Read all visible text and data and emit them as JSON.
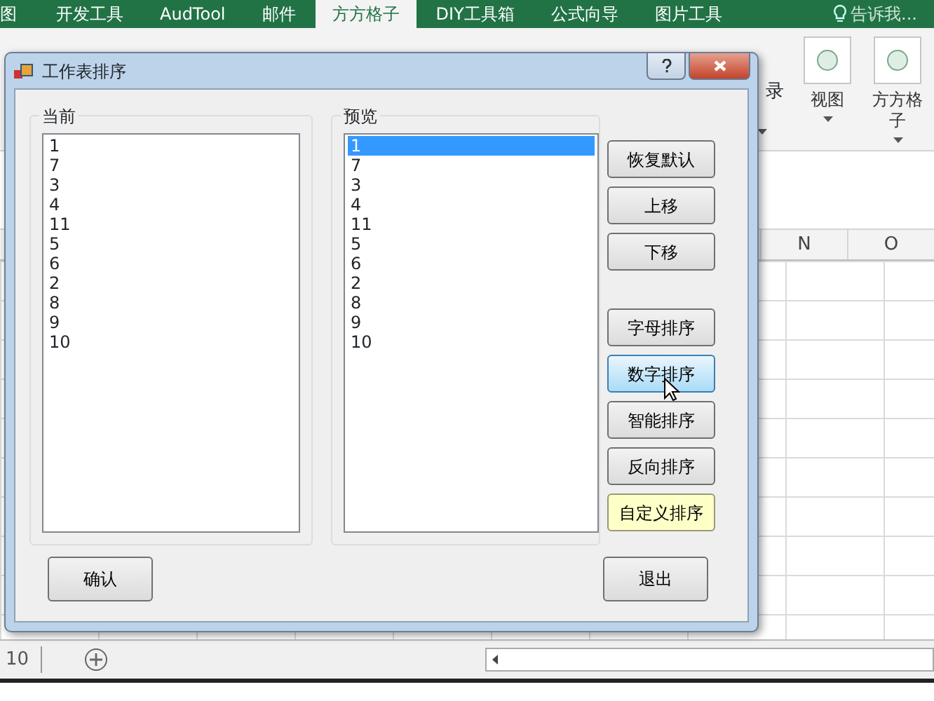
{
  "ribbon_tabs": [
    {
      "label": "图",
      "selected": false
    },
    {
      "label": "开发工具",
      "selected": false
    },
    {
      "label": "AudTool",
      "selected": false
    },
    {
      "label": "邮件",
      "selected": false
    },
    {
      "label": "方方格子",
      "selected": true
    },
    {
      "label": "DIY工具箱",
      "selected": false
    },
    {
      "label": "公式向导",
      "selected": false
    },
    {
      "label": "图片工具",
      "selected": false
    }
  ],
  "tell_me": "告诉我...",
  "ribbon_commands": [
    {
      "label": "视图"
    },
    {
      "label": "方方格子"
    }
  ],
  "ribbon_partial": "录",
  "columns": [
    "N",
    "O"
  ],
  "status_bar": {
    "row_number": "10"
  },
  "dialog": {
    "title": "工作表排序",
    "current": {
      "label": "当前",
      "items": [
        "1",
        "7",
        "3",
        "4",
        "11",
        "5",
        "6",
        "2",
        "8",
        "9",
        "10"
      ]
    },
    "preview": {
      "label": "预览",
      "items": [
        {
          "text": "1",
          "selected": true
        },
        {
          "text": "7",
          "selected": false
        },
        {
          "text": "3",
          "selected": false
        },
        {
          "text": "4",
          "selected": false
        },
        {
          "text": "11",
          "selected": false
        },
        {
          "text": "5",
          "selected": false
        },
        {
          "text": "6",
          "selected": false
        },
        {
          "text": "2",
          "selected": false
        },
        {
          "text": "8",
          "selected": false
        },
        {
          "text": "9",
          "selected": false
        },
        {
          "text": "10",
          "selected": false
        }
      ]
    },
    "move_buttons": [
      {
        "label": "恢复默认"
      },
      {
        "label": "上移"
      },
      {
        "label": "下移"
      }
    ],
    "sort_buttons": [
      {
        "label": "字母排序",
        "kind": "normal"
      },
      {
        "label": "数字排序",
        "kind": "hover"
      },
      {
        "label": "智能排序",
        "kind": "normal"
      },
      {
        "label": "反向排序",
        "kind": "normal"
      },
      {
        "label": "自定义排序",
        "kind": "highlight"
      }
    ],
    "ok_button": "确认",
    "exit_button": "退出"
  }
}
